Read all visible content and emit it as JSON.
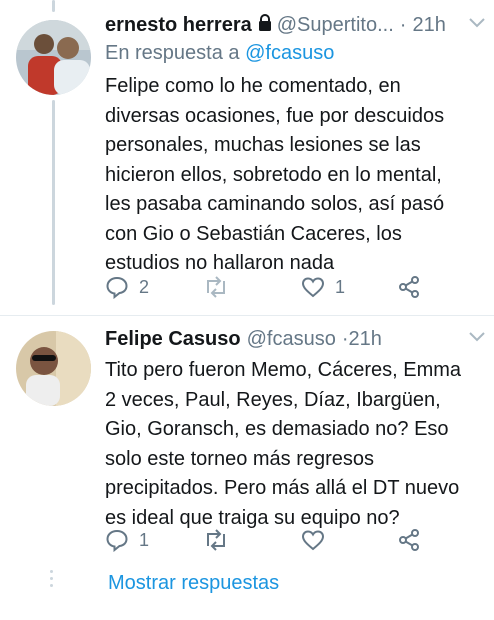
{
  "tweets": [
    {
      "name": "ernesto herrera",
      "handle": "@Supertito...",
      "sep": "·",
      "time": "21h",
      "reply_prefix": "En respuesta a ",
      "reply_mention": "@fcasuso",
      "text": "Felipe como lo he comentado, en diversas ocasiones, fue por descuidos personales, muchas lesiones se las hicieron ellos, sobretodo en lo mental, les pasaba caminando solos, así pasó con Gio o Sebastián Caceres, los estudios no hallaron nada",
      "reply_count": "2",
      "retweet_count": "",
      "like_count": "1"
    },
    {
      "name": "Felipe Casuso",
      "handle": "@fcasuso",
      "sep": "·",
      "time": "21h",
      "text": "Tito pero fueron Memo, Cáceres, Emma 2 veces, Paul, Reyes, Díaz, Ibargüen, Gio, Goransch, es demasiado no? Eso solo este torneo más regresos precipitados. Pero más allá el DT nuevo es ideal que traiga su equipo no?",
      "reply_count": "1",
      "retweet_count": "",
      "like_count": ""
    }
  ],
  "show_replies": "Mostrar respuestas",
  "colors": {
    "accent": "#1b95e0",
    "secondary": "#657786",
    "text": "#14171a",
    "line": "#ccd6dd"
  }
}
